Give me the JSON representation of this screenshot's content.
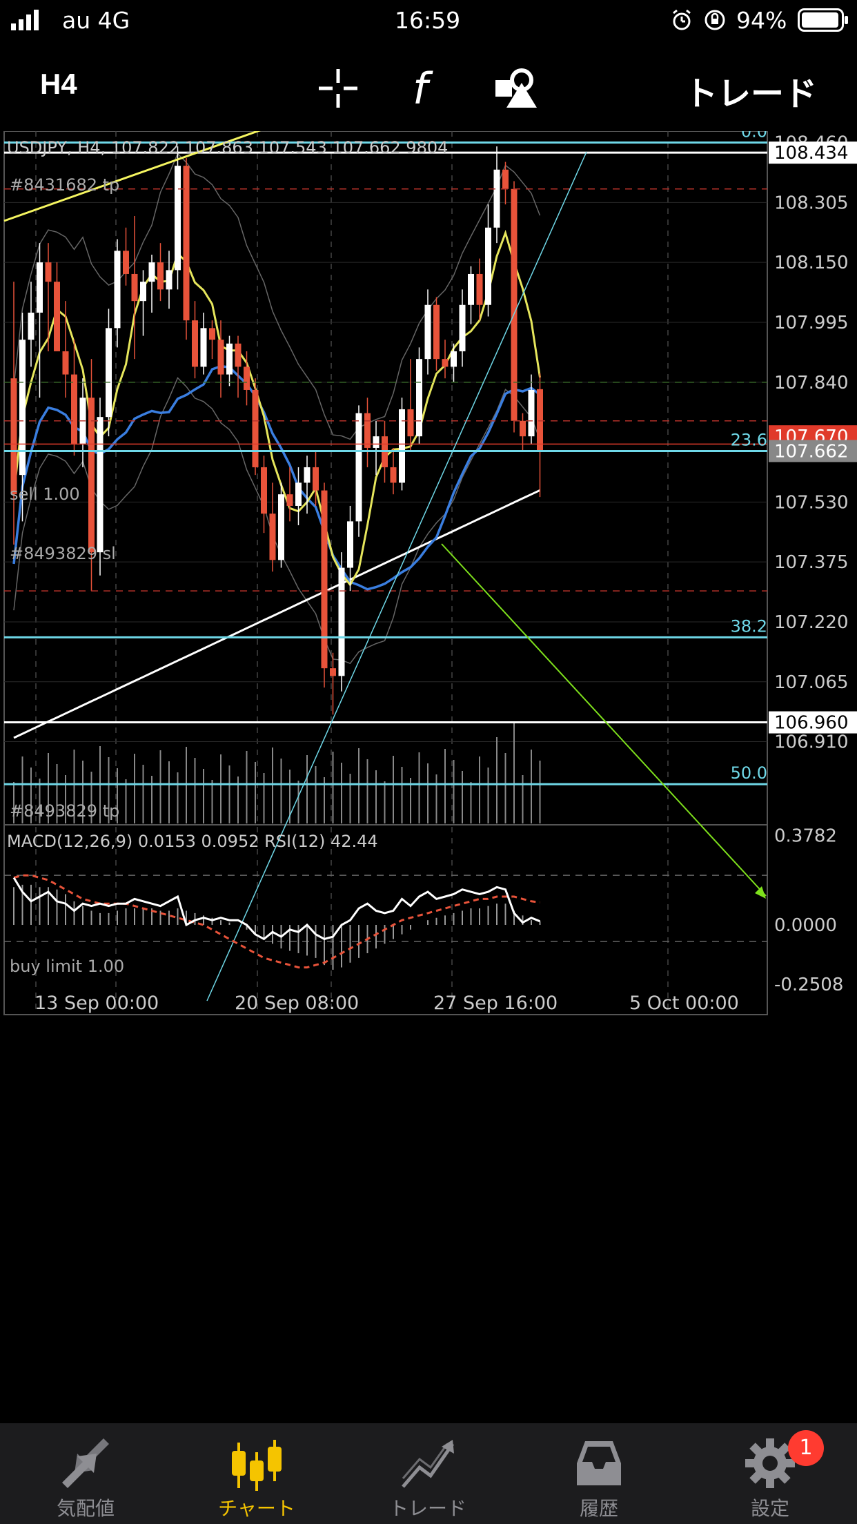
{
  "status_bar": {
    "carrier": "au 4G",
    "time": "16:59",
    "battery": "94%",
    "icons": [
      "signal-bars-icon",
      "alarm-icon",
      "rotation-lock-icon",
      "battery-icon"
    ]
  },
  "toolbar": {
    "timeframe": "H4",
    "icons": [
      "crosshair-icon",
      "indicators-function-icon",
      "objects-icon"
    ],
    "trade_label": "トレード"
  },
  "chart": {
    "info": "USDJPY, H4, 107.822 107.863 107.543 107.662 9804",
    "price_ticks": [
      "108.460",
      "108.305",
      "108.150",
      "107.995",
      "107.840",
      "107.530",
      "107.375",
      "107.220",
      "107.065",
      "106.910"
    ],
    "date_ticks": [
      "13 Sep 00:00",
      "20 Sep 08:00",
      "27 Sep 16:00",
      "5 Oct 00:00"
    ],
    "order_labels": [
      "#8431682 tp",
      "sell 1.00",
      "#8493829 sl",
      "#8493829 tp",
      "buy limit 1.00"
    ],
    "price_tags": {
      "tp": "108.434",
      "bid": "107.662",
      "ask_partial": "107.670",
      "buy_limit": "106.960"
    },
    "fib_levels": [
      "0.0",
      "23.6",
      "38.2",
      "50.0"
    ],
    "colors": {
      "bull": "#ffffff",
      "bear": "#e8533a",
      "fib": "#6fd8e8",
      "ma_fast": "#e6e65c",
      "ma_mid": "#3a7ee0",
      "ma_slow": "#ffffff",
      "trend_green": "#7ee01c"
    }
  },
  "indicator": {
    "info": "MACD(12,26,9) 0.0153 0.0952 RSI(12) 42.44",
    "ticks": [
      "0.3782",
      "0.0000",
      "-0.2508"
    ]
  },
  "chart_data": {
    "type": "candlestick",
    "symbol": "USDJPY",
    "timeframe": "H4",
    "last_bar": {
      "open": 107.822,
      "high": 107.863,
      "low": 107.543,
      "close": 107.662,
      "volume": 9804
    },
    "ylim": [
      106.86,
      108.49
    ],
    "x_tick_labels": [
      "13 Sep 00:00",
      "20 Sep 08:00",
      "27 Sep 16:00",
      "5 Oct 00:00"
    ],
    "horizontal_lines": [
      {
        "label": "#8431682 tp",
        "value": 108.434
      },
      {
        "label": "#8493829 tp",
        "value": 107.3
      },
      {
        "label": "buy limit 1.00",
        "value": 106.96
      }
    ],
    "fibonacci": [
      {
        "level": "0.0",
        "value": 108.46
      },
      {
        "level": "23.6",
        "value": 107.662
      },
      {
        "level": "38.2",
        "value": 107.18
      },
      {
        "level": "50.0",
        "value": 106.8
      }
    ],
    "ohlc": [
      [
        107.85,
        108.1,
        107.42,
        107.55
      ],
      [
        107.6,
        108.02,
        107.48,
        107.95
      ],
      [
        107.95,
        108.1,
        107.88,
        108.02
      ],
      [
        108.02,
        108.2,
        107.8,
        108.15
      ],
      [
        108.15,
        108.2,
        107.92,
        108.1
      ],
      [
        108.1,
        108.15,
        107.96,
        107.92
      ],
      [
        107.92,
        108.05,
        107.8,
        107.86
      ],
      [
        107.86,
        107.95,
        107.65,
        107.68
      ],
      [
        107.68,
        107.85,
        107.62,
        107.8
      ],
      [
        107.8,
        107.9,
        107.3,
        107.4
      ],
      [
        107.4,
        107.8,
        107.34,
        107.75
      ],
      [
        107.75,
        108.03,
        107.7,
        107.98
      ],
      [
        107.98,
        108.21,
        107.93,
        108.18
      ],
      [
        108.18,
        108.24,
        108.09,
        108.12
      ],
      [
        108.12,
        108.27,
        107.9,
        108.05
      ],
      [
        108.05,
        108.13,
        107.96,
        108.1
      ],
      [
        108.1,
        108.17,
        108.02,
        108.15
      ],
      [
        108.15,
        108.2,
        108.05,
        108.08
      ],
      [
        108.08,
        108.18,
        108.03,
        108.13
      ],
      [
        108.13,
        108.45,
        108.08,
        108.4
      ],
      [
        108.4,
        108.42,
        107.95,
        108.0
      ],
      [
        108.0,
        108.05,
        107.85,
        107.88
      ],
      [
        107.88,
        108.02,
        107.86,
        107.98
      ],
      [
        107.98,
        108.0,
        107.9,
        107.95
      ],
      [
        107.95,
        108.0,
        107.8,
        107.86
      ],
      [
        107.86,
        107.96,
        107.83,
        107.94
      ],
      [
        107.94,
        107.96,
        107.8,
        107.88
      ],
      [
        107.88,
        107.92,
        107.78,
        107.82
      ],
      [
        107.82,
        107.85,
        107.6,
        107.62
      ],
      [
        107.62,
        107.65,
        107.45,
        107.5
      ],
      [
        107.5,
        107.58,
        107.35,
        107.38
      ],
      [
        107.38,
        107.58,
        107.36,
        107.55
      ],
      [
        107.55,
        107.62,
        107.48,
        107.52
      ],
      [
        107.52,
        107.62,
        107.47,
        107.58
      ],
      [
        107.58,
        107.65,
        107.5,
        107.62
      ],
      [
        107.62,
        107.66,
        107.52,
        107.56
      ],
      [
        107.56,
        107.58,
        107.05,
        107.1
      ],
      [
        107.1,
        107.14,
        106.98,
        107.08
      ],
      [
        107.08,
        107.4,
        107.04,
        107.36
      ],
      [
        107.36,
        107.52,
        107.3,
        107.48
      ],
      [
        107.48,
        107.78,
        107.44,
        107.76
      ],
      [
        107.76,
        107.8,
        107.62,
        107.67
      ],
      [
        107.67,
        107.74,
        107.6,
        107.7
      ],
      [
        107.7,
        107.74,
        107.58,
        107.62
      ],
      [
        107.62,
        107.67,
        107.55,
        107.58
      ],
      [
        107.58,
        107.8,
        107.56,
        107.77
      ],
      [
        107.77,
        107.9,
        107.66,
        107.7
      ],
      [
        107.7,
        107.93,
        107.68,
        107.9
      ],
      [
        107.9,
        108.08,
        107.86,
        108.04
      ],
      [
        108.04,
        108.06,
        107.87,
        107.9
      ],
      [
        107.9,
        107.95,
        107.85,
        107.88
      ],
      [
        107.88,
        107.94,
        107.84,
        107.92
      ],
      [
        107.92,
        108.08,
        107.88,
        108.04
      ],
      [
        108.04,
        108.14,
        107.99,
        108.12
      ],
      [
        108.12,
        108.16,
        108.0,
        108.04
      ],
      [
        108.04,
        108.3,
        108.01,
        108.24
      ],
      [
        108.24,
        108.45,
        108.2,
        108.39
      ],
      [
        108.39,
        108.41,
        108.3,
        108.34
      ],
      [
        108.34,
        108.36,
        107.71,
        107.74
      ],
      [
        107.74,
        107.76,
        107.66,
        107.7
      ],
      [
        107.7,
        107.86,
        107.68,
        107.82
      ],
      [
        107.822,
        107.863,
        107.543,
        107.662
      ]
    ],
    "macd_histogram": [
      0.16,
      0.17,
      0.17,
      0.16,
      0.16,
      0.15,
      0.13,
      0.1,
      0.08,
      0.06,
      0.05,
      0.05,
      0.06,
      0.07,
      0.07,
      0.07,
      0.07,
      0.06,
      0.06,
      0.07,
      0.06,
      0.05,
      0.04,
      0.03,
      0.02,
      0.01,
      0.0,
      -0.02,
      -0.04,
      -0.06,
      -0.08,
      -0.1,
      -0.11,
      -0.12,
      -0.13,
      -0.14,
      -0.17,
      -0.19,
      -0.18,
      -0.16,
      -0.14,
      -0.12,
      -0.1,
      -0.08,
      -0.06,
      -0.04,
      -0.02,
      0.0,
      0.02,
      0.03,
      0.04,
      0.05,
      0.06,
      0.07,
      0.07,
      0.08,
      0.09,
      0.09,
      0.06,
      0.04,
      0.02,
      0.0153
    ],
    "signal": [
      0.2,
      0.21,
      0.21,
      0.2,
      0.19,
      0.17,
      0.15,
      0.13,
      0.11,
      0.1,
      0.09,
      0.09,
      0.09,
      0.09,
      0.08,
      0.07,
      0.06,
      0.05,
      0.04,
      0.03,
      0.02,
      0.01,
      0.0,
      -0.02,
      -0.04,
      -0.06,
      -0.08,
      -0.1,
      -0.12,
      -0.14,
      -0.15,
      -0.16,
      -0.17,
      -0.18,
      -0.18,
      -0.17,
      -0.16,
      -0.14,
      -0.12,
      -0.1,
      -0.08,
      -0.06,
      -0.04,
      -0.02,
      0.0,
      0.02,
      0.03,
      0.04,
      0.05,
      0.06,
      0.07,
      0.08,
      0.09,
      0.1,
      0.11,
      0.11,
      0.12,
      0.12,
      0.12,
      0.11,
      0.1,
      0.0952
    ],
    "rsi_line": [
      0.2,
      0.14,
      0.1,
      0.12,
      0.14,
      0.1,
      0.09,
      0.06,
      0.09,
      0.08,
      0.09,
      0.08,
      0.09,
      0.09,
      0.11,
      0.1,
      0.09,
      0.08,
      0.1,
      0.12,
      0.0,
      0.02,
      0.03,
      0.02,
      0.03,
      0.02,
      0.02,
      0.0,
      -0.04,
      -0.06,
      -0.03,
      -0.05,
      -0.02,
      -0.03,
      0.0,
      -0.04,
      -0.06,
      -0.05,
      0.0,
      0.02,
      0.07,
      0.09,
      0.06,
      0.05,
      0.06,
      0.11,
      0.08,
      0.12,
      0.14,
      0.11,
      0.12,
      0.13,
      0.15,
      0.14,
      0.13,
      0.14,
      0.16,
      0.15,
      0.05,
      0.01,
      0.03,
      0.0153
    ]
  },
  "tab_bar": {
    "tabs": [
      {
        "label": "気配値",
        "icon": "quotes-arrows-icon",
        "active": false
      },
      {
        "label": "チャート",
        "icon": "chart-candles-icon",
        "active": true
      },
      {
        "label": "トレード",
        "icon": "trade-line-icon",
        "active": false
      },
      {
        "label": "履歴",
        "icon": "history-inbox-icon",
        "active": false
      },
      {
        "label": "設定",
        "icon": "settings-gear-icon",
        "active": false
      }
    ],
    "settings_badge": "1"
  }
}
